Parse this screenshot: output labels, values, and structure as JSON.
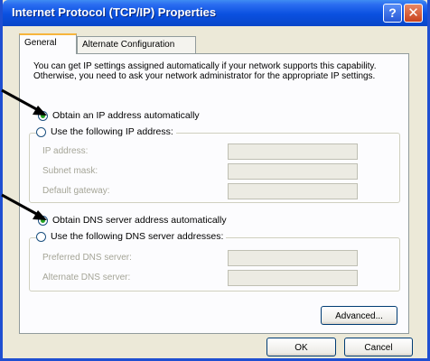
{
  "window": {
    "title": "Internet Protocol (TCP/IP) Properties",
    "help_glyph": "?",
    "close_glyph": "✕"
  },
  "tabs": [
    {
      "label": "General",
      "active": true
    },
    {
      "label": "Alternate Configuration",
      "active": false
    }
  ],
  "description": "You can get IP settings assigned automatically if your network supports this capability. Otherwise, you need to ask your network administrator for the appropriate IP settings.",
  "ip": {
    "auto_label": "Obtain an IP address automatically",
    "manual_label": "Use the following IP address:",
    "auto_selected": true,
    "fields": [
      {
        "label": "IP address:",
        "value": ""
      },
      {
        "label": "Subnet mask:",
        "value": ""
      },
      {
        "label": "Default gateway:",
        "value": ""
      }
    ]
  },
  "dns": {
    "auto_label": "Obtain DNS server address automatically",
    "manual_label": "Use the following DNS server addresses:",
    "auto_selected": true,
    "fields": [
      {
        "label": "Preferred DNS server:",
        "value": ""
      },
      {
        "label": "Alternate DNS server:",
        "value": ""
      }
    ]
  },
  "buttons": {
    "advanced": "Advanced...",
    "ok": "OK",
    "cancel": "Cancel"
  },
  "annotations": {
    "arrow_color": "#000000"
  }
}
